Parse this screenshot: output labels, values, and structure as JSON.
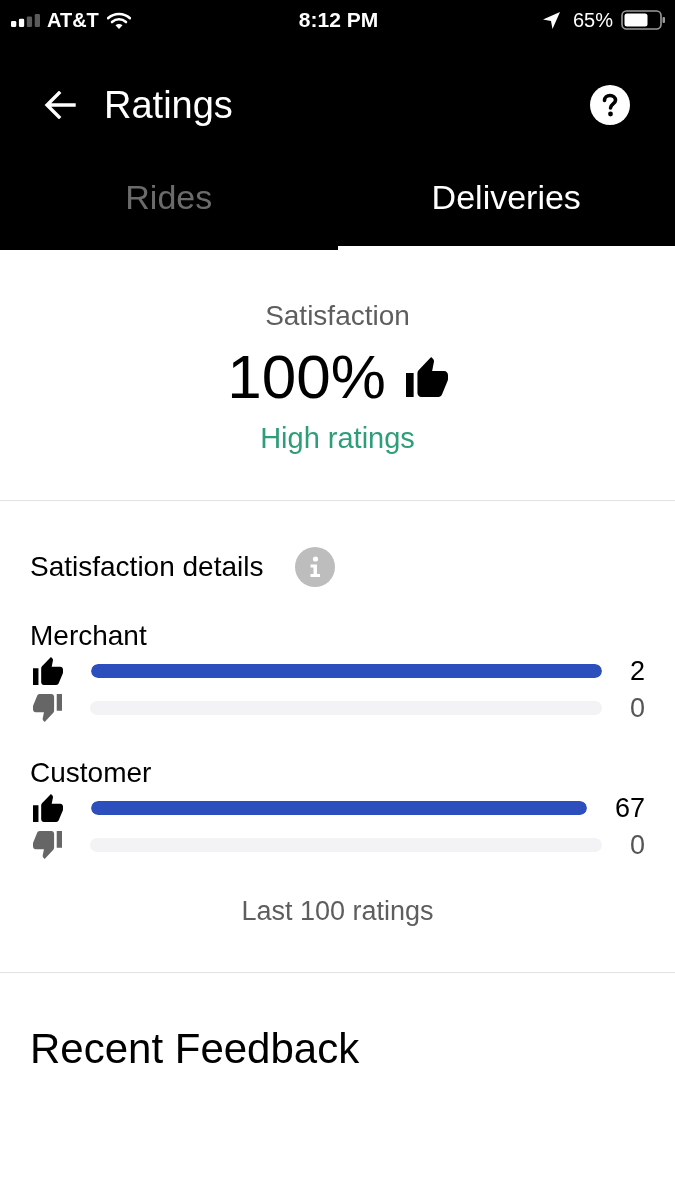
{
  "status_bar": {
    "carrier": "AT&T",
    "time": "8:12 PM",
    "battery": "65%"
  },
  "header": {
    "title": "Ratings"
  },
  "tabs": [
    {
      "label": "Rides",
      "selected": false
    },
    {
      "label": "Deliveries",
      "selected": true
    }
  ],
  "summary": {
    "label": "Satisfaction",
    "value": "100%",
    "caption": "High ratings"
  },
  "details": {
    "title": "Satisfaction details",
    "groups": [
      {
        "name": "Merchant",
        "rows": [
          {
            "kind": "up",
            "level": 1,
            "count": "2"
          },
          {
            "kind": "down",
            "level": 0,
            "count": "0"
          }
        ]
      },
      {
        "name": "Customer",
        "rows": [
          {
            "kind": "up",
            "level": 1,
            "count": "67"
          },
          {
            "kind": "down",
            "level": 0,
            "count": "0"
          }
        ]
      }
    ],
    "footnote": "Last 100 ratings"
  },
  "feedback": {
    "title": "Recent Feedback"
  }
}
